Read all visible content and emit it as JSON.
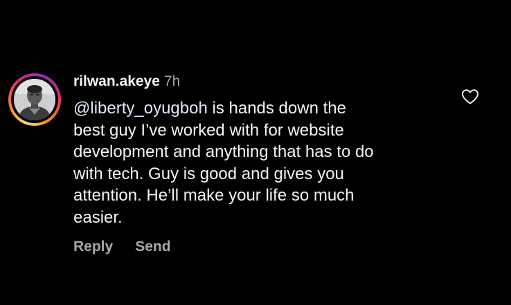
{
  "comment": {
    "username": "rilwan.akeye",
    "time": "7h",
    "mention": "@liberty_oyugboh",
    "lines": [
      " is hands down the",
      "best guy I’ve worked with for website",
      "development and anything that has to do",
      "with tech. Guy is good and gives you",
      "attention. He’ll make your life so much",
      "easier."
    ],
    "actions": {
      "reply": "Reply",
      "send": "Send"
    },
    "icons": {
      "like": "heart-icon",
      "avatar": "avatar"
    },
    "colors": {
      "background": "#000000",
      "text": "#f5f5f5",
      "secondary": "#a8a8a8"
    }
  }
}
